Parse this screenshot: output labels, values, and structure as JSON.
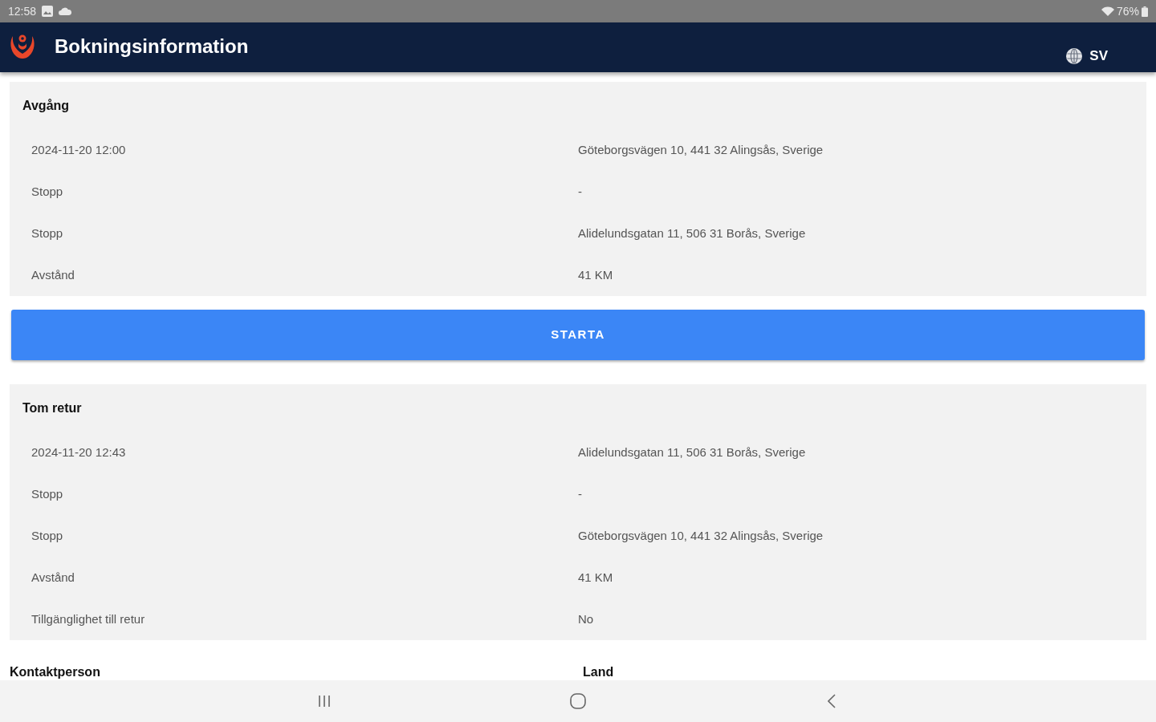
{
  "status_bar": {
    "time": "12:58",
    "battery": "76%"
  },
  "header": {
    "title": "Bokningsinformation",
    "language": "SV"
  },
  "departure": {
    "title": "Avgång",
    "rows": [
      {
        "label": "2024-11-20 12:00",
        "value": "Göteborgsvägen 10, 441 32 Alingsås, Sverige"
      },
      {
        "label": "Stopp",
        "value": "-"
      },
      {
        "label": "Stopp",
        "value": "Alidelundsgatan 11, 506 31 Borås, Sverige"
      },
      {
        "label": "Avstånd",
        "value": "41 KM"
      }
    ]
  },
  "start_button": {
    "label": "STARTA"
  },
  "empty_return": {
    "title": "Tom retur",
    "rows": [
      {
        "label": "2024-11-20 12:43",
        "value": "Alidelundsgatan 11, 506 31 Borås, Sverige"
      },
      {
        "label": "Stopp",
        "value": "-"
      },
      {
        "label": "Stopp",
        "value": "Göteborgsvägen 10, 441 32 Alingsås, Sverige"
      },
      {
        "label": "Avstånd",
        "value": "41 KM"
      },
      {
        "label": "Tillgänglighet till retur",
        "value": "No"
      }
    ]
  },
  "contact_fields": [
    "Kontaktperson",
    "Land"
  ]
}
